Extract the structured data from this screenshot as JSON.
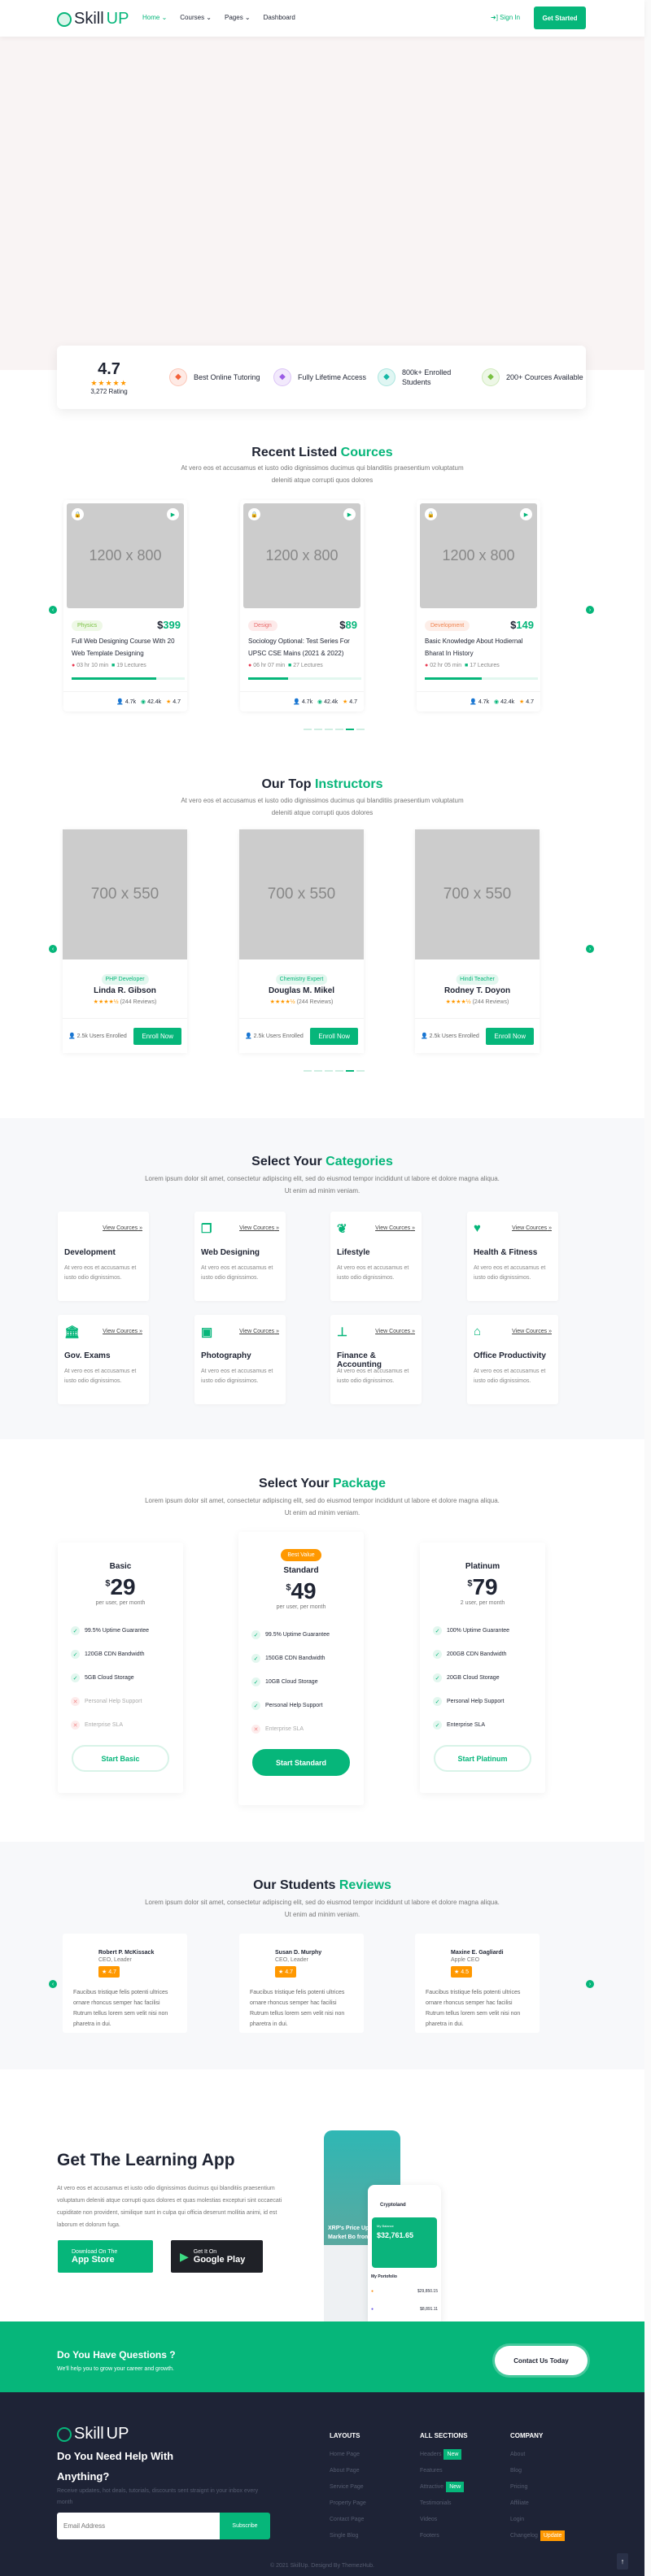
{
  "brand": {
    "name_a": "Skill",
    "name_b": "UP"
  },
  "nav": {
    "items": [
      "Home",
      "Courses",
      "Pages",
      "Dashboard"
    ],
    "active": "Home",
    "sign_in": "Sign In",
    "get_started": "Get Started"
  },
  "stats": {
    "rating": "4.7",
    "rating_label": "3,272 Rating",
    "features": [
      {
        "label": "Best Online Tutoring",
        "icon": "layers-icon",
        "color": "#f4623a"
      },
      {
        "label": "Fully Lifetime Access",
        "icon": "briefcase-icon",
        "color": "#9b5de5"
      },
      {
        "label": "800k+ Enrolled Students",
        "icon": "user-shield-icon",
        "color": "#17b8a6"
      },
      {
        "label": "200+ Cources Available",
        "icon": "book-icon",
        "color": "#7ac142"
      }
    ]
  },
  "courses": {
    "title_a": "Recent Listed ",
    "title_b": "Cources",
    "subtitle": "At vero eos et accusamus et iusto odio dignissimos ducimus qui blanditiis praesentium voluptatum deleniti atque corrupti quos dolores",
    "items": [
      {
        "image": "1200 x 800",
        "tag": "Physics",
        "tag_bg": "#eef8e6",
        "tag_color": "#7ac142",
        "price": "399",
        "title": "Full Web Designing Course With 20 Web Template Designing",
        "duration": "03 hr 10 min",
        "lectures": "19 Lectures",
        "progress": 75,
        "students": "4.7k",
        "views": "42.4k",
        "rating": "4.7"
      },
      {
        "image": "1200 x 800",
        "tag": "Design",
        "tag_bg": "#fdeaea",
        "tag_color": "#e96b6b",
        "price": "89",
        "title": "Sociology Optional: Test Series For UPSC CSE Mains (2021 & 2022)",
        "duration": "06 hr 07 min",
        "lectures": "27 Lectures",
        "progress": 35,
        "students": "4.7k",
        "views": "42.4k",
        "rating": "4.7"
      },
      {
        "image": "1200 x 800",
        "tag": "Development",
        "tag_bg": "#fdeee8",
        "tag_color": "#f08552",
        "price": "149",
        "title": "Basic Knowledge About Hodiernal Bharat In History",
        "duration": "02 hr 05 min",
        "lectures": "17 Lectures",
        "progress": 50,
        "students": "4.7k",
        "views": "42.4k",
        "rating": "4.7"
      }
    ]
  },
  "instructors": {
    "title_a": "Our Top ",
    "title_b": "Instructors",
    "subtitle": "At vero eos et accusamus et iusto odio dignissimos ducimus qui blanditiis praesentium voluptatum deleniti atque corrupti quos dolores",
    "items": [
      {
        "image": "700 x 550",
        "role": "PHP Developer",
        "name": "Linda R. Gibson",
        "rating": 4.5,
        "reviews": "(244 Reviews)",
        "enrolled": "2.5k Users Enrolled",
        "button": "Enroll Now"
      },
      {
        "image": "700 x 550",
        "role": "Chemistry Expert",
        "name": "Douglas M. Mikel",
        "rating": 4.5,
        "reviews": "(244 Reviews)",
        "enrolled": "2.5k Users Enrolled",
        "button": "Enroll Now"
      },
      {
        "image": "700 x 550",
        "role": "Hindi Teacher",
        "name": "Rodney T. Doyon",
        "rating": 4.5,
        "reviews": "(244 Reviews)",
        "enrolled": "2.5k Users Enrolled",
        "button": "Enroll Now"
      }
    ]
  },
  "categories": {
    "title_a": "Select Your ",
    "title_b": "Categories",
    "subtitle": "Lorem ipsum dolor sit amet, consectetur adipiscing elit, sed do eiusmod tempor incididunt ut labore et dolore magna aliqua. Ut enim ad minim veniam.",
    "link": "View Cources",
    "desc": "At vero eos et accusamus et iusto odio dignissimos.",
    "items": [
      {
        "name": "Development",
        "icon": "code-icon",
        "glyph": "</>"
      },
      {
        "name": "Web Designing",
        "icon": "copy-icon",
        "glyph": "❐"
      },
      {
        "name": "Lifestyle",
        "icon": "leaf-icon",
        "glyph": "❦"
      },
      {
        "name": "Health & Fitness",
        "icon": "heartbeat-icon",
        "glyph": "♥"
      },
      {
        "name": "Gov. Exams",
        "icon": "bank-icon",
        "glyph": "🏛"
      },
      {
        "name": "Photography",
        "icon": "photo-icon",
        "glyph": "▣"
      },
      {
        "name": "Finance & Accounting",
        "icon": "stamp-icon",
        "glyph": "⊥"
      },
      {
        "name": "Office Productivity",
        "icon": "building-icon",
        "glyph": "⌂"
      }
    ]
  },
  "packages": {
    "title_a": "Select Your ",
    "title_b": "Package",
    "subtitle": "Lorem ipsum dolor sit amet, consectetur adipiscing elit, sed do eiusmod tempor incididunt ut labore et dolore magna aliqua. Ut enim ad minim veniam.",
    "currency": "$",
    "items": [
      {
        "name": "Basic",
        "price": "29",
        "per": "per user, per month",
        "button": "Start Basic",
        "features": [
          [
            "99.5% Uptime Guarantee",
            true
          ],
          [
            "120GB CDN Bandwidth",
            true
          ],
          [
            "5GB Cloud Storage",
            true
          ],
          [
            "Personal Help Support",
            false
          ],
          [
            "Enterprise SLA",
            false
          ]
        ]
      },
      {
        "name": "Standard",
        "badge": "Best Value",
        "price": "49",
        "per": "per user, per month",
        "button": "Start Standard",
        "features": [
          [
            "99.5% Uptime Guarantee",
            true
          ],
          [
            "150GB CDN Bandwidth",
            true
          ],
          [
            "10GB Cloud Storage",
            true
          ],
          [
            "Personal Help Support",
            true
          ],
          [
            "Enterprise SLA",
            false
          ]
        ]
      },
      {
        "name": "Platinum",
        "price": "79",
        "per": "2 user, per month",
        "button": "Start Platinum",
        "features": [
          [
            "100% Uptime Guarantee",
            true
          ],
          [
            "200GB CDN Bandwidth",
            true
          ],
          [
            "20GB Cloud Storage",
            true
          ],
          [
            "Personal Help Support",
            true
          ],
          [
            "Enterprise SLA",
            true
          ]
        ]
      }
    ]
  },
  "reviews": {
    "title_a": "Our Students ",
    "title_b": "Reviews",
    "subtitle": "Lorem ipsum dolor sit amet, consectetur adipiscing elit, sed do eiusmod tempor incididunt ut labore et dolore magna aliqua. Ut enim ad minim veniam.",
    "items": [
      {
        "name": "Robert P. McKissack",
        "role": "CEO, Leader",
        "rating": "4.7",
        "text": "Faucibus tristique felis potenti ultrices ornare rhoncus semper hac facilisi Rutrum tellus lorem sem velit nisi non pharetra in dui."
      },
      {
        "name": "Susan D. Murphy",
        "role": "CEO, Leader",
        "rating": "4.7",
        "text": "Faucibus tristique felis potenti ultrices ornare rhoncus semper hac facilisi Rutrum tellus lorem sem velit nisi non pharetra in dui."
      },
      {
        "name": "Maxine E. Gagliardi",
        "role": "Apple CEO",
        "rating": "4.5",
        "text": "Faucibus tristique felis potenti ultrices ornare rhoncus semper hac facilisi Rutrum tellus lorem sem velit nisi non pharetra in dui."
      }
    ]
  },
  "app": {
    "title": "Get The Learning App",
    "text": "At vero eos et accusamus et iusto odio dignissimos ducimus qui blanditiis praesentium voluptatum deleniti atque corrupti quos dolores et quas molestias excepturi sint occaecati cupiditate non provident, similique sunt in culpa qui officia deserunt mollitia animi, id est laborum et dolorum fuga.",
    "appstore_small": "Download On The",
    "appstore_big": "App Store",
    "gplay_small": "Get It On",
    "gplay_big": "Google Play",
    "phone": {
      "headline": "XRP's Price Up 14 Crypto Market Bo from Crash",
      "brand": "Cryptoland",
      "balance_label": "My Balance",
      "balance": "$32,761.65",
      "portfolio": "My Portofolio",
      "btc": "$29,850.15",
      "eth": "$8,891.11"
    }
  },
  "cta": {
    "title": "Do You Have Questions ?",
    "text": "We'll help you to grow your career and growth.",
    "button": "Contact Us Today"
  },
  "footer": {
    "heading": "Do You Need Help With Anything?",
    "text": "Receive updates, hot deals, tutorials, discounts sent straignt in your inbox every month",
    "email_placeholder": "Email Address",
    "subscribe": "Subscribe",
    "columns": [
      {
        "title": "LAYOUTS",
        "links": [
          {
            "label": "Home Page"
          },
          {
            "label": "About Page"
          },
          {
            "label": "Service Page"
          },
          {
            "label": "Property Page"
          },
          {
            "label": "Contact Page"
          },
          {
            "label": "Single Blog"
          }
        ]
      },
      {
        "title": "ALL SECTIONS",
        "links": [
          {
            "label": "Headers",
            "badge": "New"
          },
          {
            "label": "Features"
          },
          {
            "label": "Attractive",
            "badge": "New"
          },
          {
            "label": "Testimonials"
          },
          {
            "label": "Videos"
          },
          {
            "label": "Footers"
          }
        ]
      },
      {
        "title": "COMPANY",
        "links": [
          {
            "label": "About"
          },
          {
            "label": "Blog"
          },
          {
            "label": "Pricing"
          },
          {
            "label": "Affiliate"
          },
          {
            "label": "Login"
          },
          {
            "label": "Changelog",
            "badge": "Update"
          }
        ]
      }
    ],
    "copyright": "© 2021 SkillUp. Designd By ThemezHub."
  },
  "colors": {
    "accent": "#06b67a",
    "orange": "#ff9800",
    "footer_bg": "#1e2336"
  }
}
